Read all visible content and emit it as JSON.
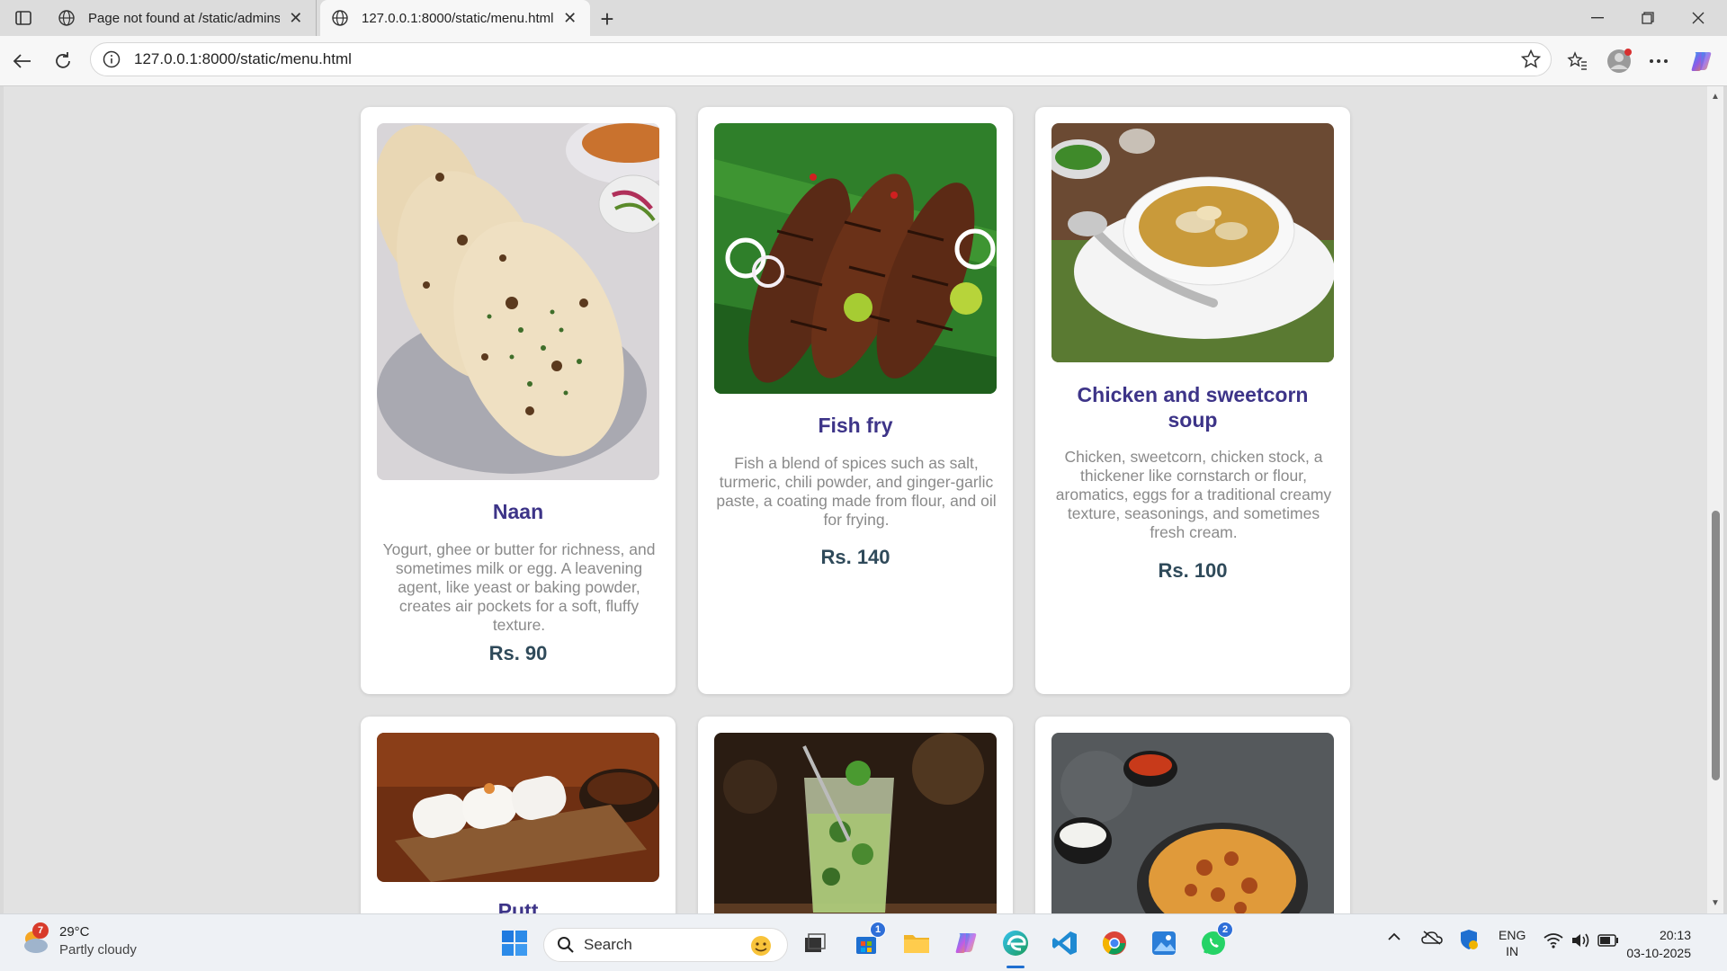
{
  "browser": {
    "tabs": [
      {
        "label": "Page not found at /static/adminst"
      },
      {
        "label": "127.0.0.1:8000/static/menu.html"
      }
    ],
    "url": "127.0.0.1:8000/static/menu.html"
  },
  "menu": {
    "items": [
      {
        "name": "Naan",
        "description": "Yogurt, ghee or butter for richness, and sometimes milk or egg. A leavening agent, like yeast or baking powder, creates air pockets for a soft, fluffy texture.",
        "price": "Rs. 90"
      },
      {
        "name": "Fish fry",
        "description": "Fish a blend of spices such as salt, turmeric, chili powder, and ginger-garlic paste, a coating made from flour, and oil for frying.",
        "price": "Rs. 140"
      },
      {
        "name": "Chicken and sweetcorn soup",
        "description": "Chicken, sweetcorn, chicken stock, a thickener like cornstarch or flour, aromatics, eggs for a traditional creamy texture, seasonings, and sometimes fresh cream.",
        "price": "Rs. 100"
      },
      {
        "name": "Putt"
      }
    ]
  },
  "taskbar": {
    "weather": {
      "temp": "29°C",
      "condition": "Partly cloudy",
      "alerts": "7"
    },
    "search_label": "Search",
    "store_badge": "1",
    "whatsapp_badge": "2",
    "language": {
      "line1": "ENG",
      "line2": "IN"
    },
    "time": "20:13",
    "date": "03-10-2025"
  },
  "colors": {
    "title": "#3d3488",
    "price": "#2f4a5a",
    "description": "#8a8a8a"
  }
}
